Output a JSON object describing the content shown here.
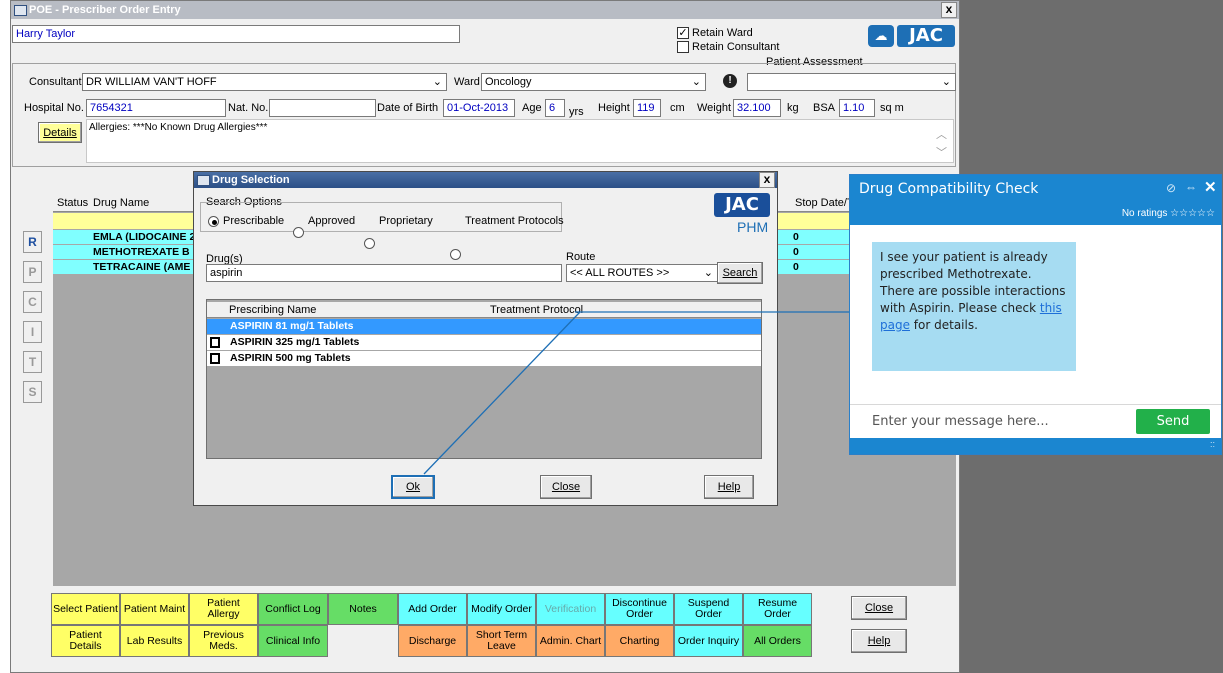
{
  "main_window": {
    "title": "POE - Prescriber Order Entry",
    "close": "x",
    "patient_name": "Harry Taylor",
    "retain_ward": "Retain Ward",
    "retain_consultant": "Retain Consultant",
    "patient_assessment": "Patient Assessment",
    "logo": "JAC",
    "consultant_label": "Consultant",
    "consultant_value": "DR WILLIAM VAN'T HOFF",
    "ward_label": "Ward",
    "ward_value": "Oncology",
    "hospital_no_label": "Hospital No.",
    "hospital_no_value": "7654321",
    "nat_no_label": "Nat. No.",
    "nat_no_value": "",
    "dob_label": "Date of Birth",
    "dob_value": "01-Oct-2013",
    "age_label": "Age",
    "age_value": "6",
    "age_unit": "yrs",
    "height_label": "Height",
    "height_value": "119",
    "height_unit": "cm",
    "weight_label": "Weight",
    "weight_value": "32.100",
    "weight_unit": "kg",
    "bsa_label": "BSA",
    "bsa_value": "1.10",
    "bsa_unit": "sq m",
    "details_btn": "Details",
    "allergies": "Allergies: ***No Known Drug Allergies***",
    "table": {
      "col_status": "Status",
      "col_drug": "Drug Name",
      "col_stop": "Stop Date/T",
      "rows": [
        {
          "drug": "EMLA (LIDOCAINE 2",
          "stop": "0"
        },
        {
          "drug": "METHOTREXATE B",
          "stop": "0"
        },
        {
          "drug": "TETRACAINE (AME",
          "stop": "0"
        }
      ]
    },
    "side_letters": [
      "R",
      "P",
      "C",
      "I",
      "T",
      "S"
    ],
    "bottom_row1": [
      "Select Patient",
      "Patient Maint",
      "Patient Allergy",
      "Conflict Log",
      "Notes",
      "Add Order",
      "Modify Order",
      "Verification",
      "Discontinue Order",
      "Suspend Order",
      "Resume Order"
    ],
    "bottom_row2": [
      "Patient Details",
      "Lab Results",
      "Previous Meds.",
      "Clinical Info",
      "",
      "Discharge",
      "Short Term Leave",
      "Admin. Chart",
      "Charting",
      "Order Inquiry",
      "All Orders"
    ],
    "close_btn": "Close",
    "help_btn": "Help"
  },
  "dialog": {
    "title": "Drug Selection",
    "close": "x",
    "search_options": "Search Options",
    "opt_prescribable": "Prescribable",
    "opt_approved": "Approved",
    "opt_proprietary": "Proprietary",
    "opt_protocols": "Treatment Protocols",
    "logo": "JAC",
    "logo_sub": "PHM",
    "drugs_label": "Drug(s)",
    "drugs_value": "aspirin",
    "route_label": "Route",
    "route_value": "<< ALL ROUTES >>",
    "search_btn": "Search",
    "col_name": "Prescribing Name",
    "col_protocol": "Treatment Protocol",
    "results": [
      "ASPIRIN 81 mg/1 Tablets",
      "ASPIRIN 325 mg/1 Tablets",
      "ASPIRIN 500 mg Tablets"
    ],
    "ok_btn": "Ok",
    "close_btn": "Close",
    "help_btn": "Help"
  },
  "chat": {
    "title": "Drug Compatibility Check",
    "ratings": "No ratings ☆☆☆☆☆",
    "message_before": "I see your patient is already prescribed Methotrexate. There are possible interactions with Aspirin. Please check ",
    "link": "this page",
    "message_after": " for details.",
    "placeholder": "Enter your message here...",
    "send": "Send",
    "colors": {
      "header": "#1b86d0",
      "bubble": "#a6dcf2",
      "send": "#22b04a"
    }
  }
}
